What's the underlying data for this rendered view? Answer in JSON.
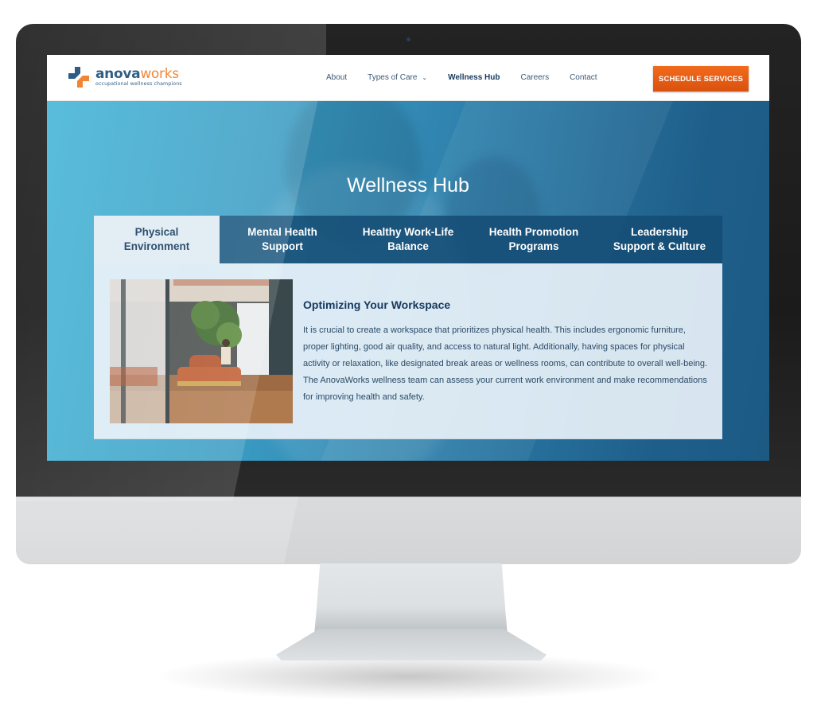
{
  "brand": {
    "name_part1": "anova",
    "name_part2": "works",
    "tagline": "occupational wellness champions",
    "colors": {
      "primary": "#1b4f7a",
      "accent": "#f07a21"
    }
  },
  "nav": {
    "items": [
      {
        "label": "About",
        "active": false
      },
      {
        "label": "Types of Care",
        "active": false,
        "has_dropdown": true
      },
      {
        "label": "Wellness Hub",
        "active": true
      },
      {
        "label": "Careers",
        "active": false
      },
      {
        "label": "Contact",
        "active": false
      }
    ],
    "dropdown_icon": "chevron-down-icon",
    "cta_label": "SCHEDULE SERVICES"
  },
  "hero": {
    "title": "Wellness Hub"
  },
  "tabs": [
    {
      "label_line1": "Physical",
      "label_line2": "Environment",
      "active": true
    },
    {
      "label_line1": "Mental Health",
      "label_line2": "Support",
      "active": false
    },
    {
      "label_line1": "Healthy Work-Life",
      "label_line2": "Balance",
      "active": false
    },
    {
      "label_line1": "Health Promotion",
      "label_line2": "Programs",
      "active": false
    },
    {
      "label_line1": "Leadership",
      "label_line2": "Support & Culture",
      "active": false
    }
  ],
  "panel": {
    "image_alt": "Person working on a laptop on an orange round sofa in a bright office lounge with plants",
    "heading": "Optimizing Your Workspace",
    "body": "It is crucial to create a workspace that prioritizes physical health. This includes ergonomic furniture, proper lighting, good air quality, and access to natural light. Additionally, having spaces for physical activity or relaxation, like designated break areas or wellness rooms, can contribute to overall well-being. The AnovaWorks wellness team can assess your current work environment and make recommendations for improving health and safety."
  }
}
